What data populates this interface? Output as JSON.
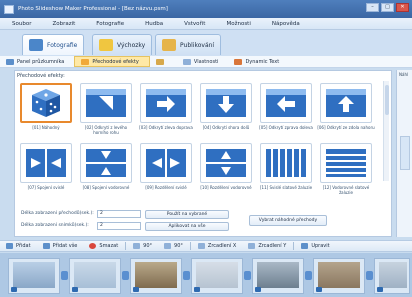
{
  "window": {
    "title": "Photo Slideshow Maker Professional - [Bez názvu.psm]"
  },
  "menu": [
    "Soubor",
    "Zobrazit",
    "Fotografie",
    "Hudba",
    "Vstvořit",
    "Možnosti",
    "Nápověda"
  ],
  "tabs": [
    {
      "label": "Fotografie",
      "active": true,
      "color": "#4b86c9"
    },
    {
      "label": "Výchozky",
      "active": false,
      "color": "#f0c640"
    },
    {
      "label": "Publikování",
      "active": false,
      "color": "#e6b44a"
    }
  ],
  "subtabs": [
    {
      "label": "Panel průzkumníka",
      "active": false,
      "color": "#5c8fca"
    },
    {
      "label": "Přechodové efekty",
      "active": true,
      "color": "#f0a93a"
    },
    {
      "label": "",
      "active": false,
      "color": "#d7a94c"
    },
    {
      "label": "Vlastnosti",
      "active": false,
      "color": "#8fb0d8"
    },
    {
      "label": "Dynamic Text",
      "active": false,
      "color": "#d9763a"
    }
  ],
  "effects_panel": {
    "heading": "Přechodové efekty:",
    "items": [
      {
        "caption": "[01] Náhodný",
        "icon": "dice-icon",
        "selected": true
      },
      {
        "caption": "[02] Odkrytí z levého horního rohu",
        "icon": "reveal-diagonal-icon"
      },
      {
        "caption": "[03] Odkrytí zleva doprava",
        "icon": "reveal-right-icon"
      },
      {
        "caption": "[04] Odkrytí shora dolů",
        "icon": "reveal-down-icon"
      },
      {
        "caption": "[05] Odkrytí zprava doleva",
        "icon": "reveal-left-icon"
      },
      {
        "caption": "[06] Odkrytí ze zdola nahoru",
        "icon": "reveal-up-icon"
      },
      {
        "caption": "[07] Spojení svislé",
        "icon": "join-vertical-icon"
      },
      {
        "caption": "[08] Spojení vodorovné",
        "icon": "join-horizontal-icon"
      },
      {
        "caption": "[09] Rozdělení svislé",
        "icon": "split-vertical-icon"
      },
      {
        "caption": "[10] Rozdělení vodorovné",
        "icon": "split-horizontal-icon"
      },
      {
        "caption": "[11] Svislé slatové žaluzie",
        "icon": "blinds-vertical-icon"
      },
      {
        "caption": "[12] Vodorovné slatové žaluzie",
        "icon": "blinds-horizontal-icon"
      }
    ]
  },
  "settings": {
    "transition_length_label": "Délka zobrazení přechodů(sek.):",
    "transition_length_value": "2",
    "photo_length_label": "Délka zobrazení snímků(sek.):",
    "photo_length_value": "2",
    "apply_selected_label": "Použít na vybrané",
    "apply_all_label": "Aplikovat na vše",
    "random_transitions_label": "Vybrat náhodné přechody"
  },
  "right_panel": {
    "label": "Náhl"
  },
  "photo_toolbar": [
    {
      "label": "Přidat",
      "icon": "add-photo-icon"
    },
    {
      "label": "Přidat vše",
      "icon": "add-all-icon"
    },
    {
      "label": "Smazat",
      "icon": "delete-icon"
    },
    {
      "label": "90°",
      "icon": "rotate-left-icon"
    },
    {
      "label": "90°",
      "icon": "rotate-right-icon"
    },
    {
      "label": "Zrcadlení X",
      "icon": "mirror-x-icon"
    },
    {
      "label": "Zrcadlení Y",
      "icon": "mirror-y-icon"
    },
    {
      "label": "Upravit",
      "icon": "edit-icon"
    }
  ],
  "filmstrip": {
    "slots": 8
  },
  "colors": {
    "accent": "#e8892d",
    "brand": "#3a66a3",
    "arrow": "#4a8fd4"
  }
}
